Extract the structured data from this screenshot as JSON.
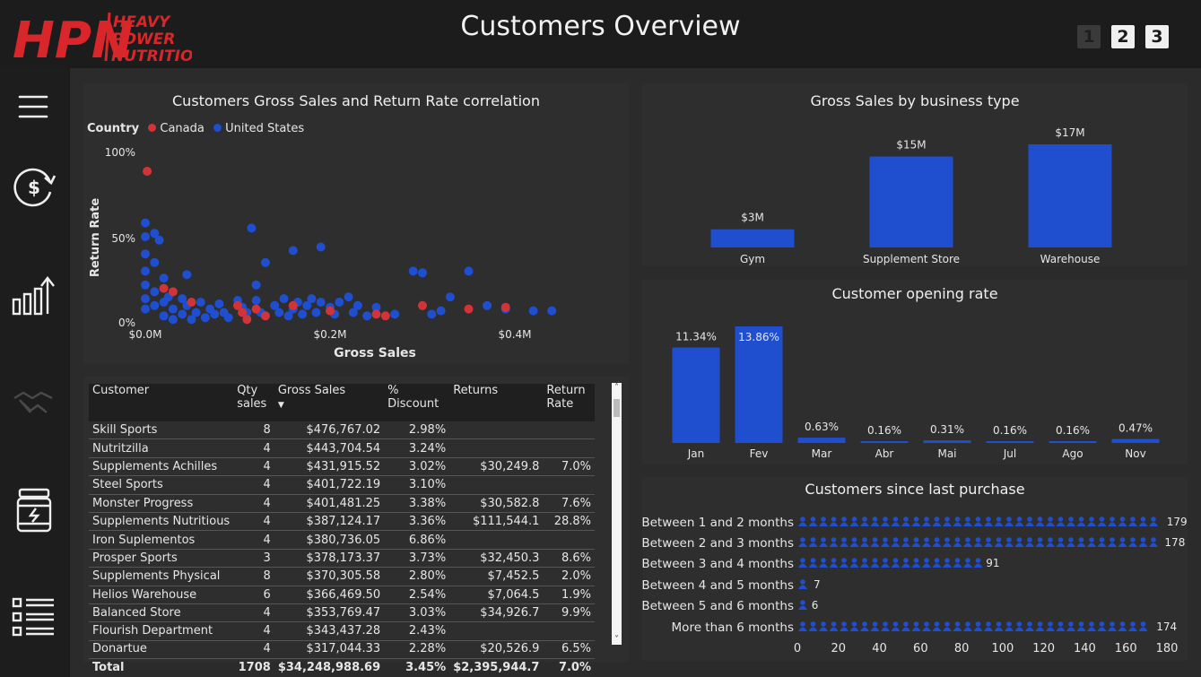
{
  "header": {
    "title": "Customers Overview",
    "logo": {
      "mark": "HPN",
      "line1": "HEAVY",
      "line2": "POWER",
      "line3": "NUTRITION"
    },
    "pages": [
      "1",
      "2",
      "3"
    ]
  },
  "sidebar": {
    "icons": [
      "menu-icon",
      "refresh-dollar-icon",
      "growth-chart-icon",
      "handshake-icon",
      "supplement-jar-icon",
      "list-icon"
    ]
  },
  "scatter": {
    "title": "Customers Gross Sales and Return Rate correlation",
    "legend_title": "Country",
    "legend": [
      {
        "name": "Canada",
        "color": "#d13438"
      },
      {
        "name": "United States",
        "color": "#1f4fcf"
      }
    ],
    "xlabel": "Gross Sales",
    "ylabel": "Return Rate",
    "xticks": [
      "$0.0M",
      "$0.2M",
      "$0.4M"
    ],
    "yticks": [
      "0%",
      "50%",
      "100%"
    ]
  },
  "table": {
    "headers": [
      "Customer",
      "Qty sales",
      "Gross Sales",
      "% Discount",
      "Returns",
      "Return Rate"
    ],
    "rows": [
      [
        "Skill Sports",
        "8",
        "$476,767.02",
        "2.98%",
        "",
        ""
      ],
      [
        "Nutritzilla",
        "4",
        "$443,704.54",
        "3.24%",
        "",
        ""
      ],
      [
        "Supplements Achilles",
        "4",
        "$431,915.52",
        "3.02%",
        "$30,249.8",
        "7.0%"
      ],
      [
        "Steel Sports",
        "4",
        "$401,722.19",
        "3.10%",
        "",
        ""
      ],
      [
        "Monster Progress",
        "4",
        "$401,481.25",
        "3.38%",
        "$30,582.8",
        "7.6%"
      ],
      [
        "Supplements Nutritious",
        "4",
        "$387,124.17",
        "3.36%",
        "$111,544.1",
        "28.8%"
      ],
      [
        "Iron Suplementos",
        "4",
        "$380,736.05",
        "6.86%",
        "",
        ""
      ],
      [
        "Prosper Sports",
        "3",
        "$378,173.37",
        "3.73%",
        "$32,450.3",
        "8.6%"
      ],
      [
        "Supplements Physical",
        "8",
        "$370,305.58",
        "2.80%",
        "$7,452.5",
        "2.0%"
      ],
      [
        "Helios Warehouse",
        "6",
        "$366,469.50",
        "2.54%",
        "$7,064.5",
        "1.9%"
      ],
      [
        "Balanced Store",
        "4",
        "$353,769.47",
        "3.03%",
        "$34,926.7",
        "9.9%"
      ],
      [
        "Flourish Department",
        "4",
        "$343,437.28",
        "2.43%",
        "",
        ""
      ],
      [
        "Donartue",
        "4",
        "$317,044.33",
        "2.28%",
        "$20,526.9",
        "6.5%"
      ]
    ],
    "total": [
      "Total",
      "1708",
      "$34,248,988.69",
      "3.45%",
      "$2,395,944.7",
      "7.0%"
    ],
    "sort_indicator": "▼",
    "scroll_up": "˄",
    "scroll_down": "˅"
  },
  "chart_data": [
    {
      "type": "scatter",
      "title": "Customers Gross Sales and Return Rate correlation",
      "xlabel": "Gross Sales",
      "ylabel": "Return Rate",
      "xlim": [
        0,
        0.46
      ],
      "ylim": [
        0,
        1.0
      ],
      "series": [
        {
          "name": "Canada",
          "points": [
            [
              0.002,
              0.88
            ],
            [
              0.02,
              0.2
            ],
            [
              0.03,
              0.18
            ],
            [
              0.05,
              0.12
            ],
            [
              0.1,
              0.1
            ],
            [
              0.105,
              0.06
            ],
            [
              0.11,
              0.02
            ],
            [
              0.12,
              0.08
            ],
            [
              0.13,
              0.04
            ],
            [
              0.16,
              0.1
            ],
            [
              0.2,
              0.07
            ],
            [
              0.25,
              0.05
            ],
            [
              0.26,
              0.04
            ],
            [
              0.3,
              0.1
            ],
            [
              0.35,
              0.08
            ],
            [
              0.39,
              0.09
            ]
          ]
        },
        {
          "name": "United States",
          "points": [
            [
              0.0,
              0.58
            ],
            [
              0.0,
              0.5
            ],
            [
              0.0,
              0.4
            ],
            [
              0.0,
              0.3
            ],
            [
              0.0,
              0.22
            ],
            [
              0.0,
              0.14
            ],
            [
              0.0,
              0.08
            ],
            [
              0.01,
              0.52
            ],
            [
              0.01,
              0.35
            ],
            [
              0.01,
              0.18
            ],
            [
              0.01,
              0.1
            ],
            [
              0.015,
              0.48
            ],
            [
              0.02,
              0.26
            ],
            [
              0.02,
              0.12
            ],
            [
              0.02,
              0.04
            ],
            [
              0.025,
              0.15
            ],
            [
              0.03,
              0.08
            ],
            [
              0.03,
              0.02
            ],
            [
              0.04,
              0.14
            ],
            [
              0.04,
              0.05
            ],
            [
              0.045,
              0.28
            ],
            [
              0.045,
              0.1
            ],
            [
              0.05,
              0.02
            ],
            [
              0.055,
              0.06
            ],
            [
              0.06,
              0.12
            ],
            [
              0.065,
              0.03
            ],
            [
              0.07,
              0.08
            ],
            [
              0.075,
              0.05
            ],
            [
              0.08,
              0.11
            ],
            [
              0.085,
              0.06
            ],
            [
              0.09,
              0.03
            ],
            [
              0.1,
              0.13
            ],
            [
              0.105,
              0.09
            ],
            [
              0.11,
              0.06
            ],
            [
              0.115,
              0.55
            ],
            [
              0.12,
              0.22
            ],
            [
              0.12,
              0.13
            ],
            [
              0.125,
              0.06
            ],
            [
              0.13,
              0.35
            ],
            [
              0.13,
              0.04
            ],
            [
              0.14,
              0.1
            ],
            [
              0.145,
              0.06
            ],
            [
              0.15,
              0.14
            ],
            [
              0.155,
              0.04
            ],
            [
              0.16,
              0.42
            ],
            [
              0.16,
              0.08
            ],
            [
              0.165,
              0.12
            ],
            [
              0.17,
              0.05
            ],
            [
              0.175,
              0.1
            ],
            [
              0.18,
              0.14
            ],
            [
              0.185,
              0.06
            ],
            [
              0.19,
              0.44
            ],
            [
              0.19,
              0.12
            ],
            [
              0.2,
              0.09
            ],
            [
              0.205,
              0.05
            ],
            [
              0.21,
              0.12
            ],
            [
              0.22,
              0.15
            ],
            [
              0.225,
              0.06
            ],
            [
              0.23,
              0.1
            ],
            [
              0.24,
              0.04
            ],
            [
              0.25,
              0.09
            ],
            [
              0.27,
              0.05
            ],
            [
              0.29,
              0.3
            ],
            [
              0.3,
              0.29
            ],
            [
              0.31,
              0.05
            ],
            [
              0.32,
              0.07
            ],
            [
              0.33,
              0.15
            ],
            [
              0.35,
              0.3
            ],
            [
              0.37,
              0.1
            ],
            [
              0.39,
              0.08
            ],
            [
              0.42,
              0.07
            ],
            [
              0.44,
              0.07
            ]
          ]
        }
      ]
    },
    {
      "type": "bar",
      "title": "Gross Sales by business type",
      "categories": [
        "Gym",
        "Supplement Store",
        "Warehouse"
      ],
      "values": [
        3,
        15,
        17
      ],
      "labels": [
        "$3M",
        "$15M",
        "$17M"
      ],
      "ylim": [
        0,
        17
      ],
      "color": "#1f4fcf"
    },
    {
      "type": "bar",
      "title": "Customer opening rate",
      "categories": [
        "Jan",
        "Fev",
        "Mar",
        "Abr",
        "Mai",
        "Jul",
        "Ago",
        "Nov"
      ],
      "values": [
        11.34,
        13.86,
        0.63,
        0.16,
        0.31,
        0.16,
        0.16,
        0.47
      ],
      "labels": [
        "11.34%",
        "13.86%",
        "0.63%",
        "0.16%",
        "0.31%",
        "0.16%",
        "0.16%",
        "0.47%"
      ],
      "ylim": [
        0,
        13.86
      ],
      "color": "#1f4fcf"
    },
    {
      "type": "bar",
      "title": "Customers since last purchase",
      "orientation": "horizontal",
      "categories": [
        "Between 1 and 2 months",
        "Between 2 and 3 months",
        "Between 3 and 4 months",
        "Between 4 and 5 months",
        "Between 5 and 6 months",
        "More than 6 months"
      ],
      "values": [
        179,
        178,
        91,
        7,
        6,
        174
      ],
      "xticks": [
        "0",
        "20",
        "40",
        "60",
        "80",
        "100",
        "120",
        "140",
        "160",
        "180"
      ],
      "xlim": [
        0,
        180
      ],
      "color": "#1f4fcf"
    }
  ]
}
